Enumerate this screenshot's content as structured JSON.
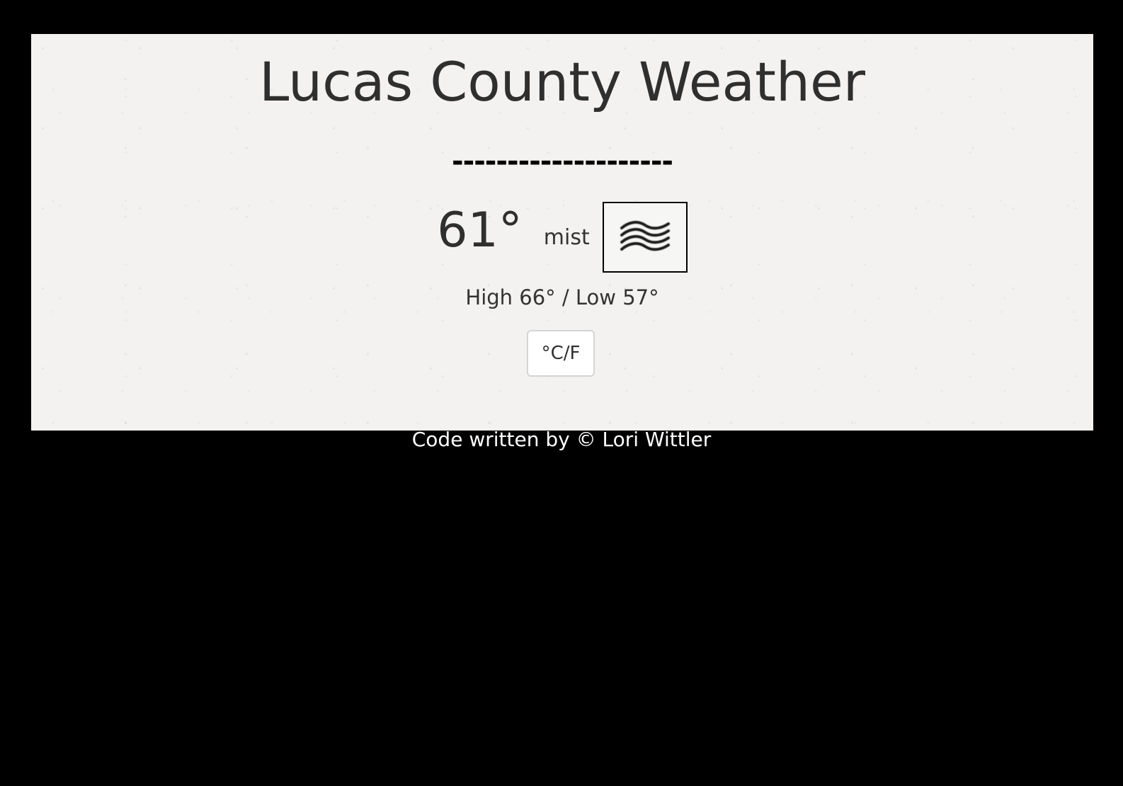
{
  "header": {
    "title": "Lucas County Weather",
    "divider": "--------------------"
  },
  "current": {
    "temperature": "61°",
    "condition": "mist",
    "icon": "mist-icon"
  },
  "range": {
    "text": "High 66° / Low 57°"
  },
  "controls": {
    "unit_toggle_label": "°C/F"
  },
  "footer": {
    "credit": "Code written by © Lori Wittler"
  },
  "colors": {
    "page_background": "#000000",
    "card_background": "#f3f2f0",
    "text": "#2f2f2f",
    "footer_text": "#ffffff"
  }
}
